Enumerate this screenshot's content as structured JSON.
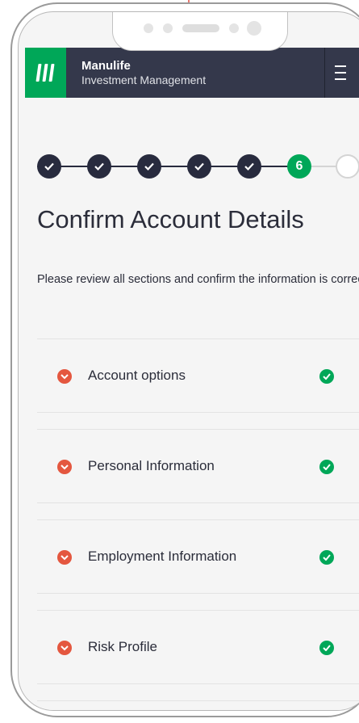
{
  "header": {
    "brand_name": "Manulife",
    "brand_sub": "Investment Management"
  },
  "stepper": {
    "current_step": "6"
  },
  "page": {
    "title": "Confirm Account Details",
    "subtitle": "Please review all sections and confirm the information is correct"
  },
  "sections": [
    {
      "label": "Account options"
    },
    {
      "label": "Personal Information"
    },
    {
      "label": "Employment Information"
    },
    {
      "label": "Risk Profile"
    }
  ],
  "colors": {
    "brand_green": "#00a758",
    "header_navy": "#34384b",
    "step_done": "#282b3e",
    "expand_red": "#e4573f"
  },
  "icons": {
    "menu": "hamburger-menu-icon",
    "step_done": "check-icon",
    "expand": "chevron-down-icon",
    "complete": "check-circle-icon"
  }
}
